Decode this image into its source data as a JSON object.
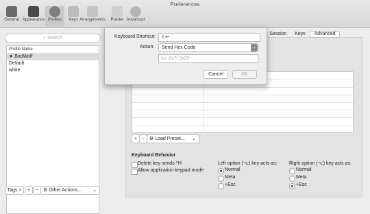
{
  "window": {
    "title": "Preferences"
  },
  "toolbar": {
    "items": [
      {
        "label": "General",
        "icon": "switch-icon"
      },
      {
        "label": "Appearance",
        "icon": "appearance-icon"
      },
      {
        "label": "Profiles",
        "icon": "person-icon"
      },
      {
        "label": "Keys",
        "icon": "keyboard-icon"
      },
      {
        "label": "Arrangements",
        "icon": "arrangements-icon"
      },
      {
        "label": "Pointer",
        "icon": "pointer-icon"
      },
      {
        "label": "Advanced",
        "icon": "gear-icon"
      }
    ],
    "selected": "Profiles"
  },
  "left": {
    "search_placeholder": "Search",
    "list_header": "Profile Name",
    "profiles": [
      "★ BadWolf",
      "Default",
      "white"
    ],
    "selected_profile": "★ BadWolf"
  },
  "bottom_bar": {
    "tags_label": "Tags >",
    "plus": "+",
    "minus": "−",
    "other_actions": "Other Actions..."
  },
  "tabs": [
    {
      "label": "Session"
    },
    {
      "label": "Keys"
    },
    {
      "label": "Advanced"
    }
  ],
  "selected_tab": "Advanced",
  "keys_panel": {
    "plus": "+",
    "minus": "−",
    "load_preset": "Load Preset...",
    "keyboard_behavior_title": "Keyboard Behavior",
    "delete_key_label": "Delete key sends ^H",
    "app_keypad_label": "Allow application keypad mode",
    "left_option_title": "Left option (⌥) key acts as:",
    "right_option_title": "Right option (⌥) key acts as:",
    "option_choices": [
      "Normal",
      "Meta",
      "+Esc"
    ],
    "left_selected": "Normal",
    "right_selected": "+Esc"
  },
  "sheet": {
    "shortcut_label": "Keyboard Shortcut:",
    "shortcut_value": "⇧↩",
    "action_label": "Action:",
    "action_value": "Send Hex Code",
    "hex_placeholder": "ex: 0x7f 0x20",
    "cancel_label": "Cancel",
    "ok_label": "OK"
  }
}
